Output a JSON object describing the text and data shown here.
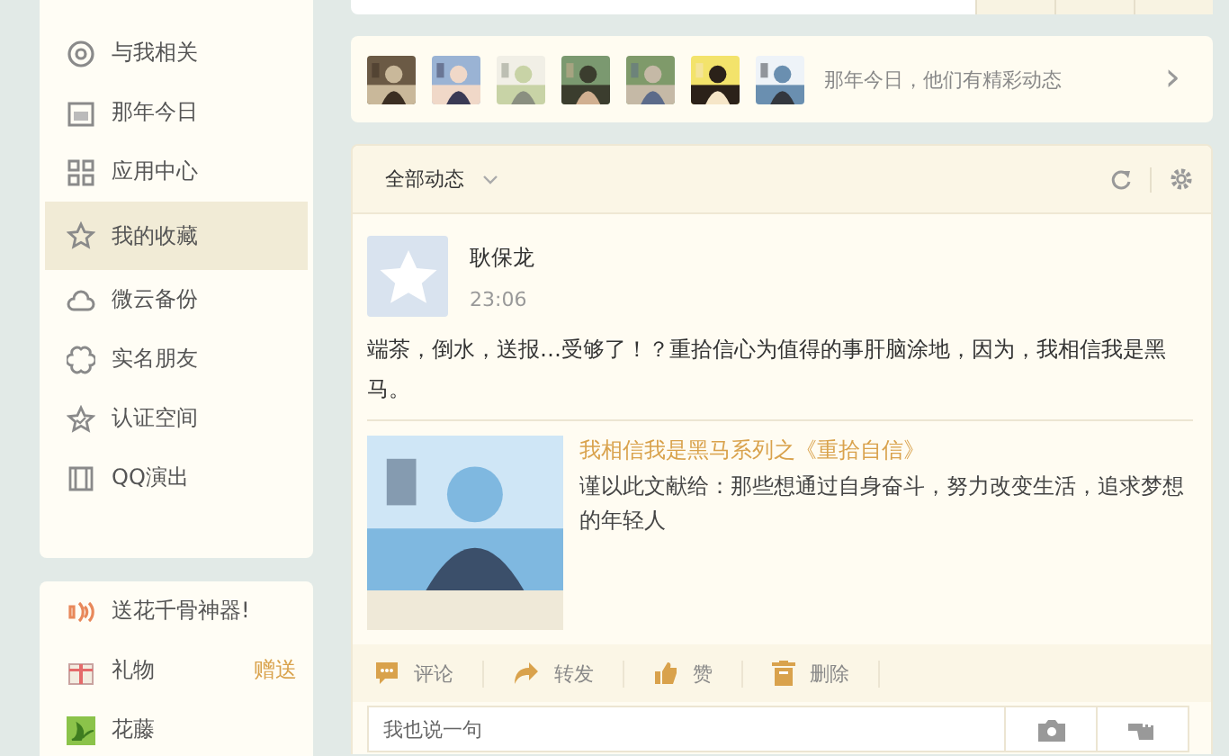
{
  "sidebar": {
    "items": [
      {
        "label": "与我相关",
        "selected": false
      },
      {
        "label": "那年今日",
        "selected": false
      },
      {
        "label": "应用中心",
        "selected": false
      },
      {
        "label": "我的收藏",
        "selected": true
      },
      {
        "label": "微云备份",
        "selected": false
      },
      {
        "label": "实名朋友",
        "selected": false
      },
      {
        "label": "认证空间",
        "selected": false
      },
      {
        "label": "QQ演出",
        "selected": false
      }
    ]
  },
  "promo": {
    "items": [
      {
        "label": "送花千骨神器!"
      },
      {
        "label": "礼物",
        "action": "赠送"
      },
      {
        "label": "花藤"
      }
    ]
  },
  "memories": {
    "text": "那年今日，他们有精彩动态",
    "arrow": "›"
  },
  "feed": {
    "filter": "全部动态",
    "post": {
      "author": "耿保龙",
      "time": "23:06",
      "text": "端茶，倒水，送报…受够了！？重拾信心为值得的事肝脑涂地，因为，我相信我是黑马。",
      "share": {
        "title": "我相信我是黑马系列之《重拾自信》",
        "summary": "谨以此文献给：那些想通过自身奋斗，努力改变生活，追求梦想的年轻人"
      },
      "actions": [
        "评论",
        "转发",
        "赞",
        "删除"
      ],
      "comment": {
        "placeholder": "我也说一句"
      }
    }
  }
}
